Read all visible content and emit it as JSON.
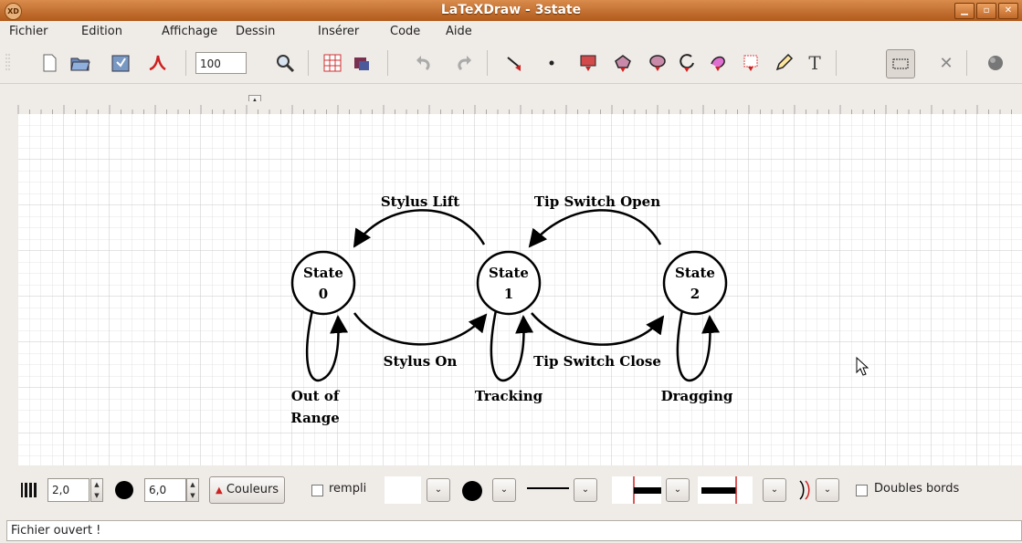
{
  "window": {
    "title": "LaTeXDraw - 3state",
    "app_icon": "XD",
    "controls": [
      "minimize-icon",
      "maximize-icon",
      "close-icon"
    ]
  },
  "menu": [
    "Fichier",
    "Edition",
    "Affichage",
    "Dessin",
    "Insérer",
    "Code",
    "Aide"
  ],
  "toolbar": {
    "zoom": "100",
    "text_tool": "T"
  },
  "diagram": {
    "states": [
      {
        "line1": "State",
        "line2": "0"
      },
      {
        "line1": "State",
        "line2": "1"
      },
      {
        "line1": "State",
        "line2": "2"
      }
    ],
    "transitions": {
      "stylus_lift": "Stylus Lift",
      "tip_switch_open": "Tip Switch Open",
      "stylus_on": "Stylus On",
      "tip_switch_close": "Tip Switch Close",
      "out_of_range_1": "Out of",
      "out_of_range_2": "Range",
      "tracking": "Tracking",
      "dragging": "Dragging"
    }
  },
  "properties": {
    "thickness": "2,0",
    "dot_size": "6,0",
    "colors_button": "Couleurs",
    "fill_label": "rempli",
    "double_border_label": "Doubles bords"
  },
  "status": "Fichier ouvert !",
  "colors": {
    "titlebar": "#c06a2c",
    "grid": "#d8d8d8",
    "accent_red": "#cc2222"
  }
}
